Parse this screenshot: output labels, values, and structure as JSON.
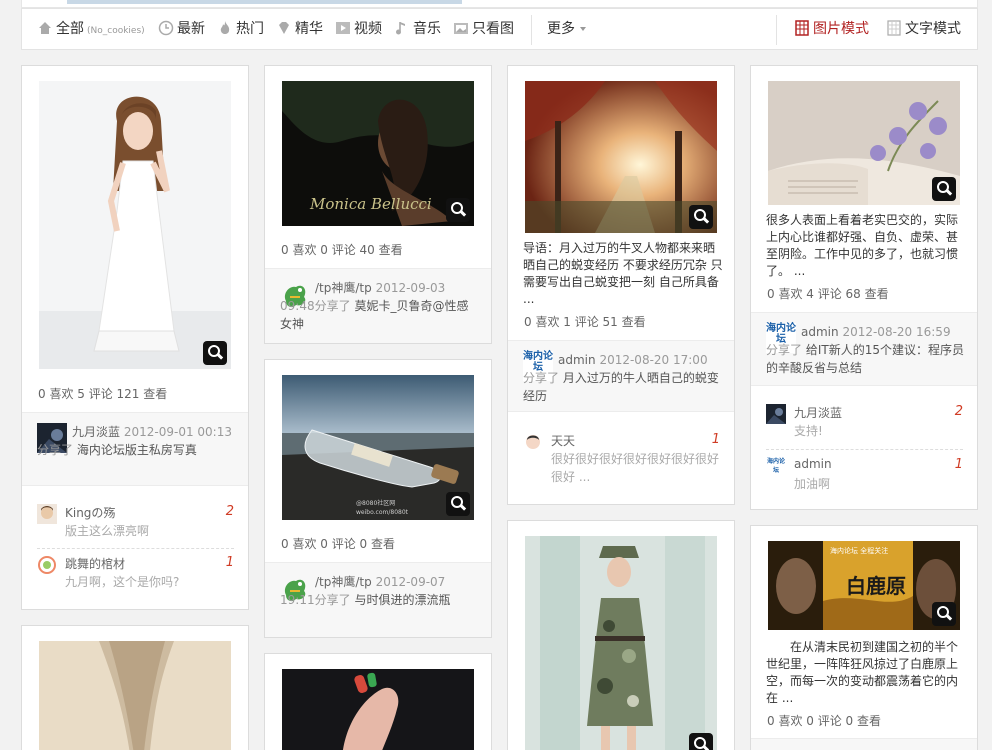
{
  "nav": {
    "items": [
      {
        "label": "全部",
        "sub": "(No_cookies)"
      },
      {
        "label": "最新"
      },
      {
        "label": "热门"
      },
      {
        "label": "精华"
      },
      {
        "label": "视频"
      },
      {
        "label": "音乐"
      },
      {
        "label": "只看图"
      }
    ],
    "more": "更多",
    "modes": [
      {
        "label": "图片模式",
        "active": true
      },
      {
        "label": "文字模式",
        "active": false
      }
    ]
  },
  "cards": {
    "c1": {
      "stats": "0 喜欢   5 评论   121 查看",
      "user": "九月淡蓝",
      "time": "2012-09-01 00:13",
      "action": "分享了",
      "title": "海内论坛版主私房写真",
      "comments": [
        {
          "name": "Kingの殇",
          "text": "版主这么漂亮啊",
          "num": "2"
        },
        {
          "name": "跳舞的棺材",
          "text": "九月啊，这个是你吗?",
          "num": "1"
        }
      ]
    },
    "c2": {
      "watermark": "Monica Bellucci",
      "stats": "0 喜欢   0 评论   40 查看",
      "user": "/tp神鹰/tp",
      "time": "2012-09-03 09:48",
      "action": "分享了",
      "title": "莫妮卡_贝鲁奇@性感女神"
    },
    "c3": {
      "credit1": "@8080社区网",
      "credit2": "weibo.com/8080t",
      "stats": "0 喜欢   0 评论   0 查看",
      "user": "/tp神鹰/tp",
      "time": "2012-09-07 19:11",
      "action": "分享了",
      "title": "与时俱进的漂流瓶"
    },
    "c4": {
      "desc": "导语：月入过万的牛叉人物都来来晒晒自己的蜕变经历 不要求经历冗杂 只需要写出自己蜕变把一刻 自己所具备 ...",
      "stats": "0 喜欢   1 评论   51 查看",
      "user": "admin",
      "time": "2012-08-20 17:00",
      "action": "分享了",
      "title": "月入过万的牛人晒自己的蜕变经历",
      "comments": [
        {
          "name": "天天",
          "text": "很好很好很好很好很好很好很好很好 ...",
          "num": "1"
        }
      ]
    },
    "c5": {
      "desc": "很多人表面上看着老实巴交的，实际上内心比谁都好强、自负、虚荣、甚至阴险。工作中见的多了，也就习惯了。 ...",
      "stats": "0 喜欢   4 评论   68 查看",
      "user": "admin",
      "time": "2012-08-20 16:59",
      "action": "分享了",
      "title": "给IT新人的15个建议：程序员的辛酸反省与总结",
      "comments": [
        {
          "name": "九月淡蓝",
          "text": "支持!",
          "num": "2"
        },
        {
          "name": "admin",
          "text": "加油啊",
          "num": "1"
        }
      ]
    },
    "c6": {
      "desc": "在从清末民初到建国之初的半个世纪里，一阵阵狂风掠过了白鹿原上空，而每一次的变动都震荡着它的内在 ...",
      "stats": "0 喜欢   0 评论   0 查看",
      "poster_top": "海内论坛 全程关注",
      "poster_title": "白鹿原"
    }
  },
  "logo_text": "海内论坛"
}
